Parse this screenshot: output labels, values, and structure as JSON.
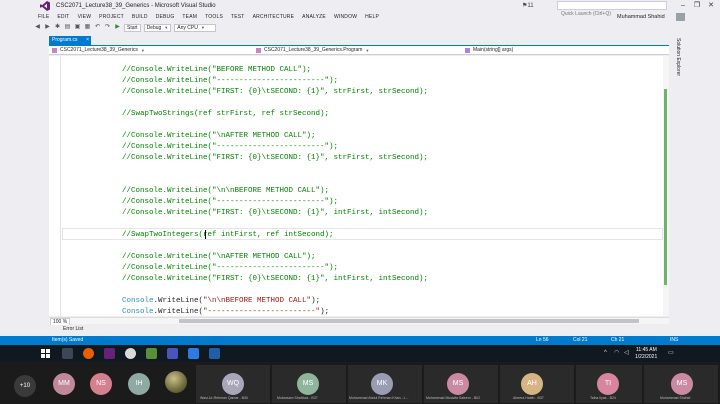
{
  "window": {
    "title": "CSC2071_Lecture38_39_Generics - Microsoft Visual Studio",
    "notifications": "11",
    "quick_launch_placeholder": "Quick Launch (Ctrl+Q)",
    "controls": [
      "–",
      "❐",
      "✕"
    ]
  },
  "menu": [
    "FILE",
    "EDIT",
    "VIEW",
    "PROJECT",
    "BUILD",
    "DEBUG",
    "TEAM",
    "TOOLS",
    "TEST",
    "ARCHITECTURE",
    "ANALYZE",
    "WINDOW",
    "HELP"
  ],
  "user_name": "Muhammad Shahid",
  "toolbar": {
    "config": "Debug",
    "platform": "Any CPU",
    "start_label": "Start"
  },
  "document_tab": {
    "label": "Program.cs",
    "close": "×"
  },
  "navbar": {
    "project": "CSC2071_Lecture38_39_Generics",
    "class": "CSC2071_Lecture38_39_Generics.Program",
    "member": "Main(string[] args)"
  },
  "code_lines": [
    "//Console.WriteLine(\"BEFORE METHOD CALL\");",
    "//Console.WriteLine(\"------------------------\");",
    "//Console.WriteLine(\"FIRST: {0}\\tSECOND: {1}\", strFirst, strSecond);",
    "",
    "//SwapTwoStrings(ref strFirst, ref strSecond);",
    "",
    "//Console.WriteLine(\"\\nAFTER METHOD CALL\");",
    "//Console.WriteLine(\"------------------------\");",
    "//Console.WriteLine(\"FIRST: {0}\\tSECOND: {1}\", strFirst, strSecond);",
    "",
    "",
    "//Console.WriteLine(\"\\n\\nBEFORE METHOD CALL\");",
    "//Console.WriteLine(\"------------------------\");",
    "//Console.WriteLine(\"FIRST: {0}\\tSECOND: {1}\", intFirst, intSecond);",
    "",
    "//SwapTwoIntegers(ref intFirst, ref intSecond);",
    "",
    "//Console.WriteLine(\"\\nAFTER METHOD CALL\");",
    "//Console.WriteLine(\"------------------------\");",
    "//Console.WriteLine(\"FIRST: {0}\\tSECOND: {1}\", intFirst, intSecond);"
  ],
  "live_lines": [
    {
      "ident": "Console",
      "rest": ".WriteLine(",
      "str": "\"\\n\\nBEFORE METHOD CALL\"",
      "end": ");"
    },
    {
      "ident": "Console",
      "rest": ".WriteLine(",
      "str": "\"------------------------\"",
      "end": ");"
    }
  ],
  "solution_explorer_label": "Solution Explorer",
  "zoom": "100 %",
  "error_list": "Error List",
  "status": {
    "message": "Item(s) Saved",
    "line": "Ln 56",
    "col": "Col 21",
    "ch": "Ch 21",
    "mode": "INS"
  },
  "taskbar": {
    "time": "11:45 AM",
    "date": "1/22/2021"
  },
  "participants": {
    "more_count": "+10",
    "avatars": [
      {
        "initials": "MM",
        "color": "#c1889a"
      },
      {
        "initials": "NS",
        "color": "#d5808f"
      },
      {
        "initials": "IH",
        "color": "#8fa9a3"
      }
    ],
    "tiles": [
      {
        "initials": "WQ",
        "color": "#a8a6b8",
        "name": "Wasi-Ur-Rehman Qamar - B30"
      },
      {
        "initials": "MS",
        "color": "#8fb59d",
        "name": "Mubarsam Shahbaz - B37"
      },
      {
        "initials": "MK",
        "color": "#9a9cb3",
        "name": "Muhammad Abdul Rehman Khan - L..."
      },
      {
        "initials": "MS",
        "color": "#c98aa2",
        "name": "Muhammad Mustafa Saleem - B02"
      },
      {
        "initials": "AH",
        "color": "#d4b583",
        "name": "Abeera Habib - B37"
      },
      {
        "initials": "TI",
        "color": "#d886a0",
        "name": "Talha Ilyas - B24"
      },
      {
        "initials": "MS",
        "color": "#c98aa2",
        "name": "Muhammad Shahid"
      }
    ]
  }
}
